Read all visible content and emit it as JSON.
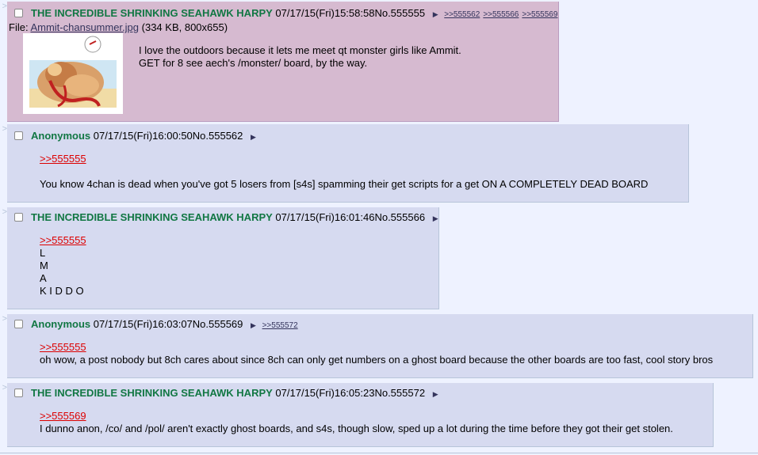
{
  "posts": [
    {
      "name": "THE INCREDIBLE SHRINKING SEAHAWK HARPY",
      "datetime": "07/17/15(Fri)15:58:58",
      "no": "No.555555",
      "backlinks": [
        ">>555562",
        ">>555566",
        ">>555569"
      ],
      "file_label": "File:",
      "file_name": "Ammit-chansummer.jpg",
      "file_info": "(334 KB, 800x655)",
      "lines": [
        "I love the outdoors because it lets me meet qt monster girls like Ammit.",
        "GET for 8 see aech's /monster/ board, by the way."
      ]
    },
    {
      "name": "Anonymous",
      "datetime": "07/17/15(Fri)16:00:50",
      "no": "No.555562",
      "quote": ">>555555",
      "lines": [
        "You know 4chan is dead when you've got 5 losers from [s4s] spamming their get scripts for a get ON A COMPLETELY DEAD BOARD"
      ]
    },
    {
      "name": "THE INCREDIBLE SHRINKING SEAHAWK HARPY",
      "datetime": "07/17/15(Fri)16:01:46",
      "no": "No.555566",
      "quote": ">>555555",
      "lines": [
        "L",
        "M",
        "A",
        "K I D D O"
      ]
    },
    {
      "name": "Anonymous",
      "datetime": "07/17/15(Fri)16:03:07",
      "no": "No.555569",
      "backlinks": [
        ">>555572"
      ],
      "quote": ">>555555",
      "lines": [
        "oh wow, a post nobody but 8ch cares about since 8ch can only get numbers on a ghost board because the other boards are too fast, cool story bros"
      ]
    },
    {
      "name": "THE INCREDIBLE SHRINKING SEAHAWK HARPY",
      "datetime": "07/17/15(Fri)16:05:23",
      "no": "No.555572",
      "quote": ">>555569",
      "lines": [
        "I dunno anon, /co/ and /pol/ aren't exactly ghost boards, and s4s, though slow, sped up a lot during the time before they got their get stolen."
      ]
    }
  ],
  "ui": {
    "side_arrow": ">",
    "menu_arrow": "▶"
  },
  "colors": {
    "page_bg": "#eef2ff",
    "post_bg": "#d6daf0",
    "highlight_bg": "#d6bad0",
    "name": "#117743",
    "quotelink": "#dd0000",
    "link": "#34345c"
  }
}
